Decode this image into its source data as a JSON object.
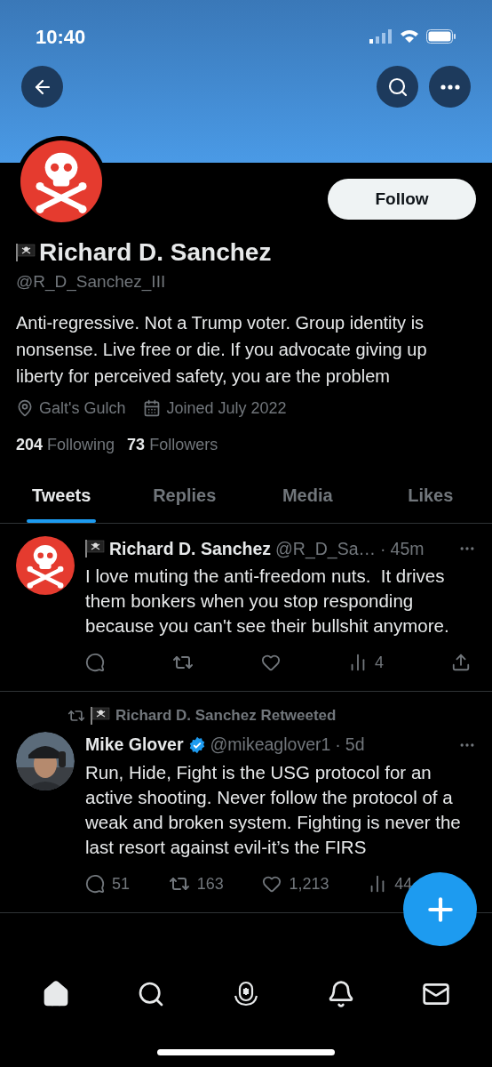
{
  "status_bar": {
    "time": "10:40"
  },
  "profile": {
    "name": "Richard D. Sanchez",
    "handle": "@R_D_Sanchez_III",
    "follow_button": "Follow",
    "bio": "Anti-regressive. Not a Trump voter. Group identity is nonsense. Live free or die. If you advocate giving up liberty for perceived safety, you are the problem",
    "location": "Galt's Gulch",
    "joined": "Joined July 2022",
    "following_count": "204",
    "following_label": "Following",
    "followers_count": "73",
    "followers_label": "Followers"
  },
  "tabs": [
    {
      "label": "Tweets",
      "selected": true
    },
    {
      "label": "Replies",
      "selected": false
    },
    {
      "label": "Media",
      "selected": false
    },
    {
      "label": "Likes",
      "selected": false
    }
  ],
  "tweets": [
    {
      "flag": true,
      "author": "Richard D. Sanchez",
      "verified": false,
      "handle": "@R_D_Sa…",
      "separator": "·",
      "time": "45m",
      "text": "I love muting the anti-freedom nuts.  It drives them bonkers when you stop responding because you can't see their bullshit anymore.",
      "views": "4"
    },
    {
      "retweeted_by": "Richard D. Sanchez Retweeted",
      "flag": false,
      "author": "Mike Glover",
      "verified": true,
      "handle": "@mikeaglover1",
      "separator": "·",
      "time": "5d",
      "text": "Run, Hide, Fight is the USG protocol for an active shooting. Never follow the protocol of a weak and broken system. Fighting is never the last resort against evil-it’s the FIRS",
      "replies": "51",
      "retweets": "163",
      "likes": "1,213",
      "views": "44"
    }
  ],
  "nav": [
    {
      "kind": "home",
      "selected": true
    },
    {
      "kind": "search",
      "selected": false
    },
    {
      "kind": "spaces",
      "selected": false
    },
    {
      "kind": "notifications",
      "selected": false
    },
    {
      "kind": "messages",
      "selected": false
    }
  ]
}
